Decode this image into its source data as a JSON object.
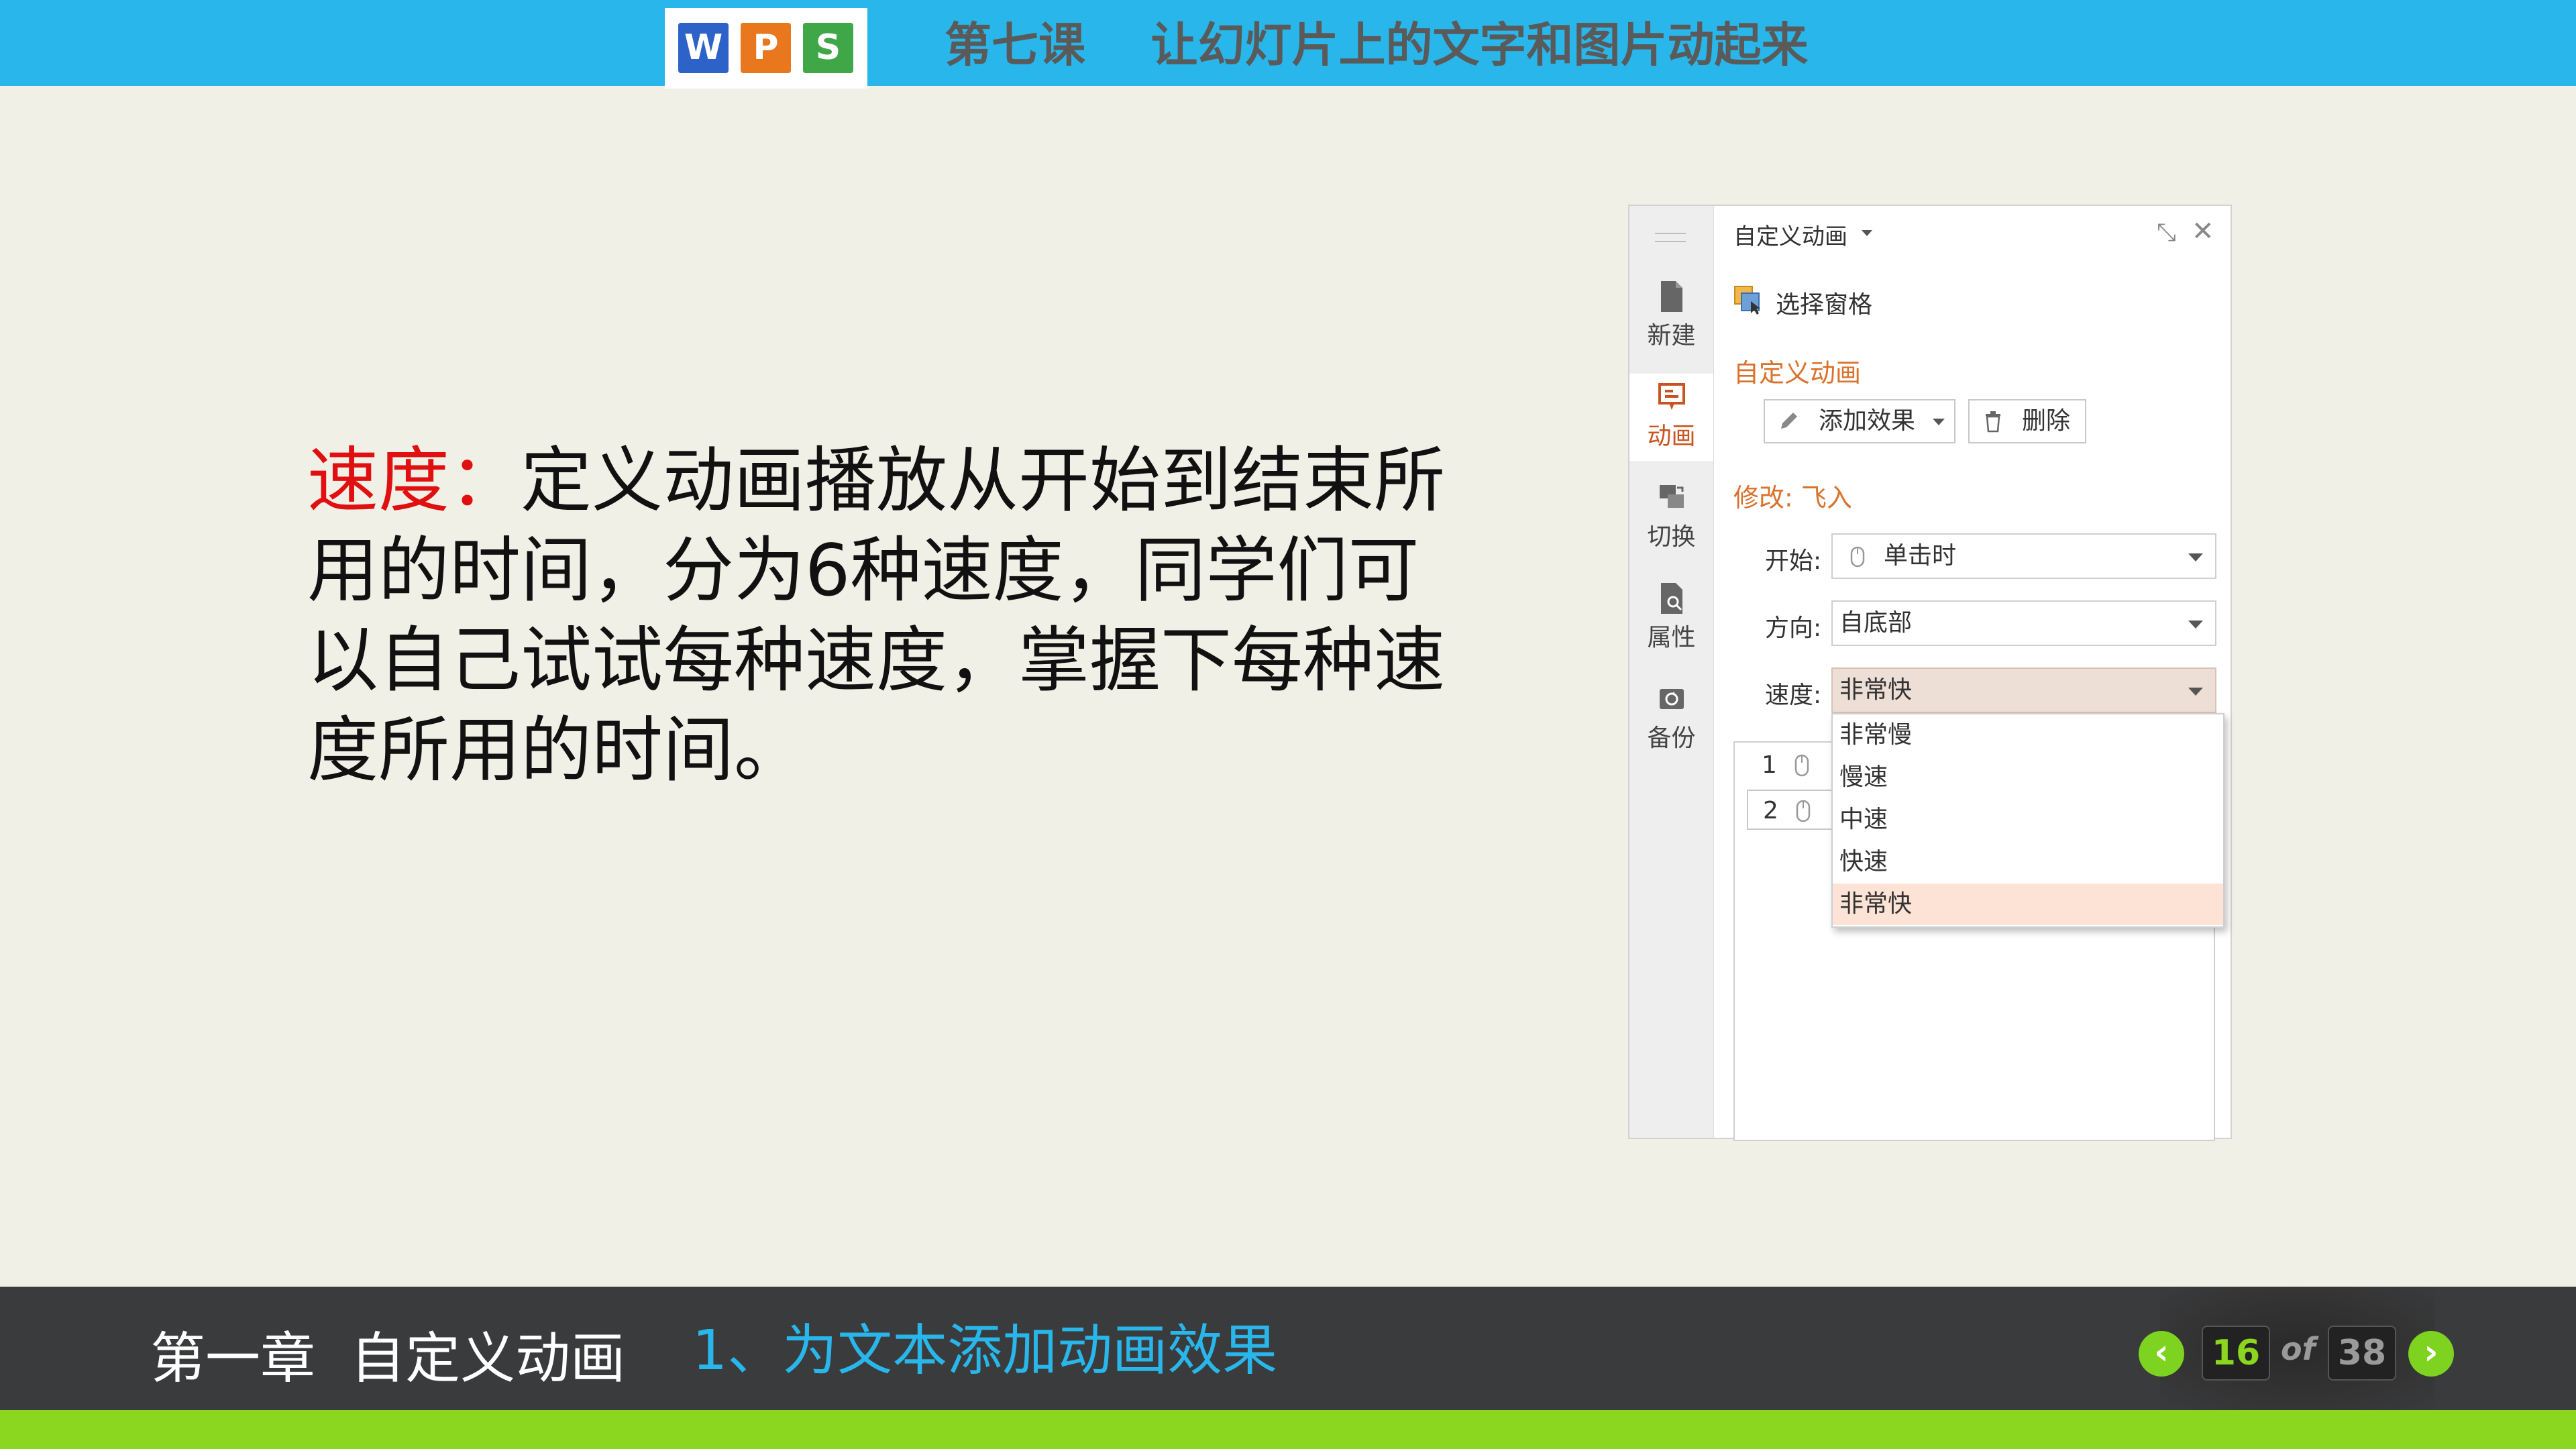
{
  "header": {
    "logo_letters": [
      "W",
      "P",
      "S"
    ],
    "logo_colors": {
      "w": "#2d62c9",
      "p": "#e9771d",
      "s": "#3fa748"
    },
    "title": "第七课    让幻灯片上的文字和图片动起来",
    "bar_color": "#29b6ea"
  },
  "body": {
    "highlight": "速度：",
    "text": "定义动画播放从开始到结束所用的时间，分为6种速度，同学们可以自己试试每种速度，掌握下每种速度所用的时间。"
  },
  "panel": {
    "title": "自定义动画",
    "sidebar": [
      {
        "label": "新建",
        "icon": "document-icon"
      },
      {
        "label": "动画",
        "icon": "animation-icon",
        "active": true
      },
      {
        "label": "切换",
        "icon": "transition-icon"
      },
      {
        "label": "属性",
        "icon": "properties-icon"
      },
      {
        "label": "备份",
        "icon": "backup-icon"
      }
    ],
    "selection_pane_label": "选择窗格",
    "section_title": "自定义动画",
    "add_effect_label": "添加效果",
    "delete_label": "删除",
    "modify_label": "修改: 飞入",
    "start": {
      "label": "开始:",
      "value": "单击时"
    },
    "direction": {
      "label": "方向:",
      "value": "自底部"
    },
    "speed": {
      "label": "速度:",
      "value": "非常快",
      "options": [
        "非常慢",
        "慢速",
        "中速",
        "快速",
        "非常快"
      ],
      "selected_index": 4
    },
    "effects_list": [
      {
        "number": "1"
      },
      {
        "number": "2"
      }
    ],
    "accent_color": "#d9722d"
  },
  "footer": {
    "chapter": "第一章  自定义动画",
    "section": "1、为文本添加动画效果",
    "current_page": "16",
    "of_label": "of",
    "total_pages": "38",
    "prev_symbol": "‹",
    "next_symbol": "›"
  }
}
